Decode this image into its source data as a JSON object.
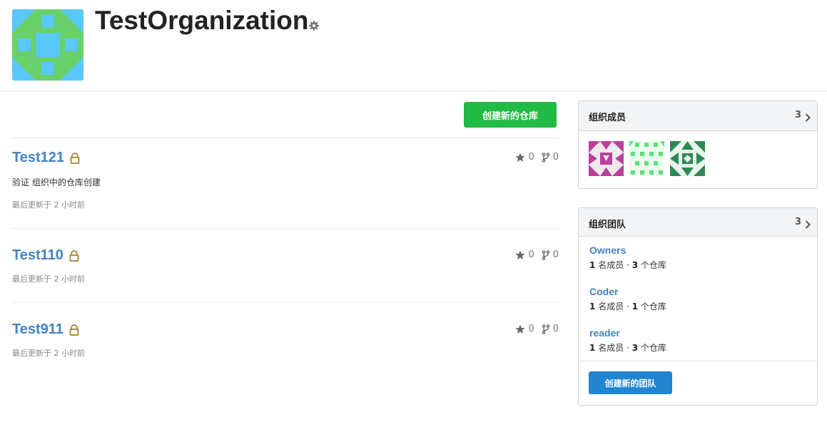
{
  "organization": {
    "name": "TestOrganization",
    "avatar_colors": {
      "bg": "#6ad06a",
      "fg": "#5ac8fa"
    }
  },
  "actions": {
    "create_repo_label": "创建新的仓库",
    "create_team_label": "创建新的团队"
  },
  "repos": [
    {
      "name": "Test121",
      "description": "验证 组织中的仓库创建",
      "updated": "最后更新于 2 小时前",
      "stars": "0",
      "forks": "0",
      "private": true
    },
    {
      "name": "Test110",
      "description": "",
      "updated": "最后更新于 2 小时前",
      "stars": "0",
      "forks": "0",
      "private": true
    },
    {
      "name": "Test911",
      "description": "",
      "updated": "最后更新于 2 小时前",
      "stars": "0",
      "forks": "0",
      "private": true
    }
  ],
  "members_panel": {
    "title": "组织成员",
    "count": "3",
    "avatar_colors": [
      "#b8419b",
      "#5de07a",
      "#2d8a55"
    ]
  },
  "teams_panel": {
    "title": "组织团队",
    "count": "3",
    "teams": [
      {
        "name": "Owners",
        "members": "1",
        "members_label": "名成员",
        "separator": "·",
        "repos": "3",
        "repos_label": "个仓库"
      },
      {
        "name": "Coder",
        "members": "1",
        "members_label": "名成员",
        "separator": "·",
        "repos": "1",
        "repos_label": "个仓库"
      },
      {
        "name": "reader",
        "members": "1",
        "members_label": "名成员",
        "separator": "·",
        "repos": "3",
        "repos_label": "个仓库"
      }
    ]
  },
  "colors": {
    "link": "#4183c4",
    "green_button": "#21ba45",
    "blue_button": "#2185d0",
    "lock": "#a0862a"
  },
  "icons": {
    "settings": "gear-icon",
    "lock": "lock-icon",
    "star": "star-icon",
    "fork": "fork-icon",
    "chevron": "chevron-right-icon"
  }
}
